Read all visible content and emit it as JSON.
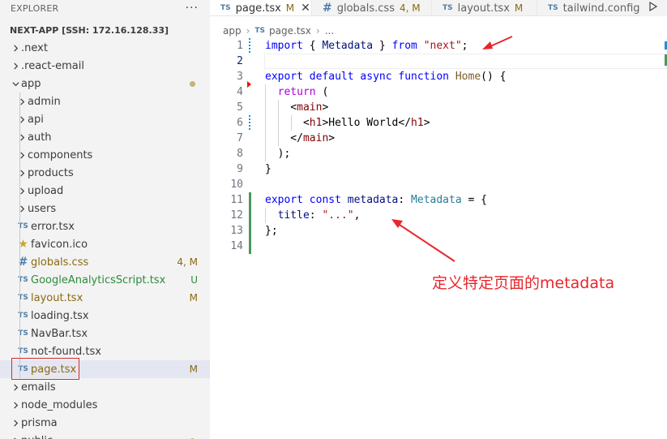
{
  "explorer": {
    "title": "EXPLORER",
    "more": "···",
    "root": "NEXT-APP [SSH: 172.16.128.33]",
    "items": [
      {
        "label": ".next",
        "kind": "folder",
        "depth": 0
      },
      {
        "label": ".react-email",
        "kind": "folder",
        "depth": 0
      },
      {
        "label": "app",
        "kind": "folder-open",
        "depth": 0,
        "dot": true
      },
      {
        "label": "admin",
        "kind": "folder",
        "depth": 1
      },
      {
        "label": "api",
        "kind": "folder",
        "depth": 1
      },
      {
        "label": "auth",
        "kind": "folder",
        "depth": 1
      },
      {
        "label": "components",
        "kind": "folder",
        "depth": 1
      },
      {
        "label": "products",
        "kind": "folder",
        "depth": 1
      },
      {
        "label": "upload",
        "kind": "folder",
        "depth": 1
      },
      {
        "label": "users",
        "kind": "folder",
        "depth": 1
      },
      {
        "label": "error.tsx",
        "kind": "ts",
        "depth": 1
      },
      {
        "label": "favicon.ico",
        "kind": "star",
        "depth": 1
      },
      {
        "label": "globals.css",
        "kind": "css",
        "depth": 1,
        "badge": "4, M",
        "color": "mod"
      },
      {
        "label": "GoogleAnalyticsScript.tsx",
        "kind": "ts",
        "depth": 1,
        "badge": "U",
        "color": "green"
      },
      {
        "label": "layout.tsx",
        "kind": "ts",
        "depth": 1,
        "badge": "M",
        "color": "mod"
      },
      {
        "label": "loading.tsx",
        "kind": "ts",
        "depth": 1
      },
      {
        "label": "NavBar.tsx",
        "kind": "ts",
        "depth": 1
      },
      {
        "label": "not-found.tsx",
        "kind": "ts",
        "depth": 1
      },
      {
        "label": "page.tsx",
        "kind": "ts",
        "depth": 1,
        "badge": "M",
        "color": "mod",
        "selected": true
      },
      {
        "label": "emails",
        "kind": "folder",
        "depth": 0
      },
      {
        "label": "node_modules",
        "kind": "folder",
        "depth": 0
      },
      {
        "label": "prisma",
        "kind": "folder",
        "depth": 0
      },
      {
        "label": "public",
        "kind": "folder",
        "depth": 0,
        "dot": true
      }
    ]
  },
  "tabs": [
    {
      "icon": "TS",
      "label": "page.tsx",
      "status": "M",
      "active": true,
      "close": "✕"
    },
    {
      "icon": "#",
      "label": "globals.css",
      "status": "4, M"
    },
    {
      "icon": "TS",
      "label": "layout.tsx",
      "status": "M"
    },
    {
      "icon": "TS",
      "label": "tailwind.config.t"
    }
  ],
  "breadcrumb": [
    "app",
    "page.tsx",
    "..."
  ],
  "breadcrumb_icon": "TS",
  "code": [
    [
      [
        "kw",
        "import"
      ],
      [
        "p",
        " { "
      ],
      [
        "vr",
        "Metadata"
      ],
      [
        "p",
        " } "
      ],
      [
        "kw",
        "from"
      ],
      [
        "p",
        " "
      ],
      [
        "str",
        "\"next\""
      ],
      [
        "p",
        ";"
      ]
    ],
    [],
    [
      [
        "kw",
        "export"
      ],
      [
        "p",
        " "
      ],
      [
        "kw",
        "default"
      ],
      [
        "p",
        " "
      ],
      [
        "kw",
        "async"
      ],
      [
        "p",
        " "
      ],
      [
        "kw",
        "function"
      ],
      [
        "p",
        " "
      ],
      [
        "fn",
        "Home"
      ],
      [
        "p",
        "() {"
      ]
    ],
    [
      [
        "p",
        "  "
      ],
      [
        "ctl",
        "return"
      ],
      [
        "p",
        " ("
      ]
    ],
    [
      [
        "p",
        "    <"
      ],
      [
        "tag",
        "main"
      ],
      [
        "p",
        ">"
      ]
    ],
    [
      [
        "p",
        "      <"
      ],
      [
        "tag",
        "h1"
      ],
      [
        "p",
        ">Hello World</"
      ],
      [
        "tag",
        "h1"
      ],
      [
        "p",
        ">"
      ]
    ],
    [
      [
        "p",
        "    </"
      ],
      [
        "tag",
        "main"
      ],
      [
        "p",
        ">"
      ]
    ],
    [
      [
        "p",
        "  );"
      ]
    ],
    [
      [
        "p",
        "}"
      ]
    ],
    [],
    [
      [
        "kw",
        "export"
      ],
      [
        "p",
        " "
      ],
      [
        "kw",
        "const"
      ],
      [
        "p",
        " "
      ],
      [
        "vr",
        "metadata"
      ],
      [
        "p",
        ": "
      ],
      [
        "tp",
        "Metadata"
      ],
      [
        "p",
        " = {"
      ]
    ],
    [
      [
        "p",
        "  "
      ],
      [
        "vr",
        "title"
      ],
      [
        "p",
        ": "
      ],
      [
        "str",
        "\"...\""
      ],
      [
        "p",
        ","
      ]
    ],
    [
      [
        "p",
        "};"
      ]
    ],
    []
  ],
  "annotation": "定义特定页面的metadata",
  "colors": {
    "annotation": "#e8262c",
    "git_added": "#48985d",
    "git_modified": "#2090d3",
    "git_deleted": "#e51400"
  }
}
